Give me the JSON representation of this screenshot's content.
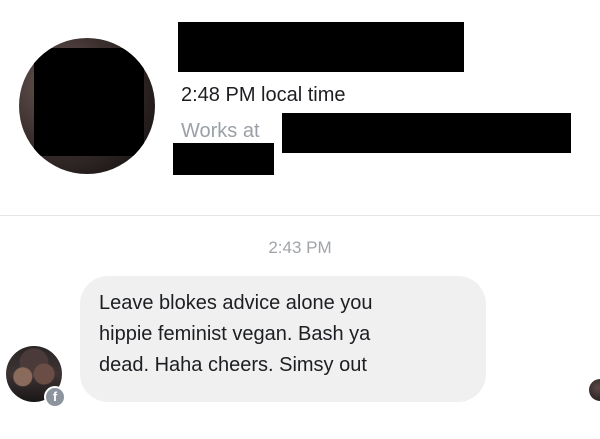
{
  "profile": {
    "local_time": "2:48 PM local time",
    "works_at_label": "Works at"
  },
  "conversation": {
    "timestamp": "2:43 PM",
    "message": {
      "lines": [
        "Leave blokes advice alone you",
        "hippie feminist vegan. Bash ya",
        "dead. Haha cheers. Simsy out"
      ]
    },
    "sender_badge_icon": "facebook-icon"
  },
  "colors": {
    "bubble_bg": "#f0f0f1",
    "secondary_text": "#9aa0a6",
    "primary_text": "#1c1e21"
  }
}
